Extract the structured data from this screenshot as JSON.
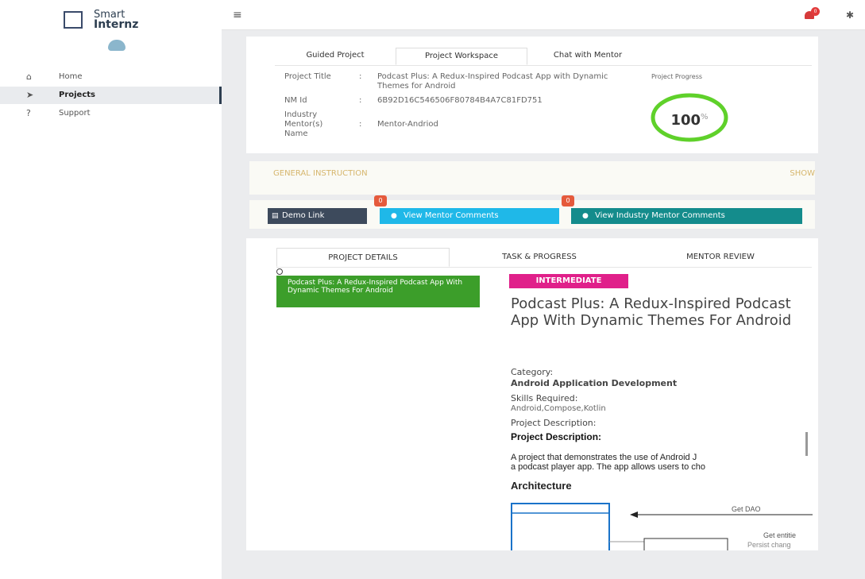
{
  "brand": {
    "line1": "Smart",
    "line2": "Internz"
  },
  "sidebar": {
    "items": [
      {
        "label": "Home",
        "icon": "home-icon",
        "glyph": "⌂"
      },
      {
        "label": "Projects",
        "icon": "paper-plane-icon",
        "glyph": "➤"
      },
      {
        "label": "Support",
        "icon": "question-icon",
        "glyph": "?"
      }
    ]
  },
  "topbar": {
    "menu_glyph": "≡",
    "notification_count": "0",
    "settings_glyph": "✱"
  },
  "overview": {
    "tabs": [
      "Guided Project",
      "Project Workspace",
      "Chat with Mentor"
    ],
    "project_title_label": "Project Title",
    "project_title": "Podcast Plus: A Redux-Inspired Podcast App with Dynamic Themes for Android",
    "nm_id_label": "NM Id",
    "nm_id": "6B92D16C546506F80784B4A7C81FD751",
    "mentor_label": "Industry Mentor(s) Name",
    "mentor": "Mentor-Andriod",
    "colon": ":",
    "progress_label": "Project Progress",
    "progress_value": "100",
    "progress_unit": "%",
    "progress_fraction": 1.0
  },
  "instruction": {
    "title": "GENERAL INSTRUCTION",
    "toggle": "SHOW"
  },
  "actions": {
    "demo": "Demo Link",
    "mentor_comments": "View Mentor Comments",
    "mentor_comments_count": "0",
    "industry_comments": "View Industry Mentor Comments",
    "industry_comments_count": "0",
    "colors": {
      "demo": "#3d4a5c",
      "mentor": "#1fb8e8",
      "industry": "#148c8c"
    }
  },
  "details": {
    "tabs": [
      "PROJECT DETAILS",
      "TASK & PROGRESS",
      "MENTOR REVIEW"
    ],
    "list_item": "Podcast Plus: A Redux-Inspired Podcast App With Dynamic Themes For Android",
    "level": "INTERMEDIATE",
    "title": "Podcast Plus: A Redux-Inspired Podcast App With Dynamic Themes For Android",
    "category_label": "Category:",
    "category": "Android Application Development",
    "skills_label": "Skills Required:",
    "skills": "Android,Compose,Kotlin",
    "description_label": "Project Description:",
    "description_heading": "Project Description:",
    "description_line1": "A project that demonstrates the use of Android J",
    "description_line2": "a podcast player app. The app allows users to cho",
    "architecture": "Architecture",
    "diagram_labels": {
      "get_dao": "Get DAO",
      "get_entities": "Get entitie",
      "partial": "Persist chang"
    }
  }
}
